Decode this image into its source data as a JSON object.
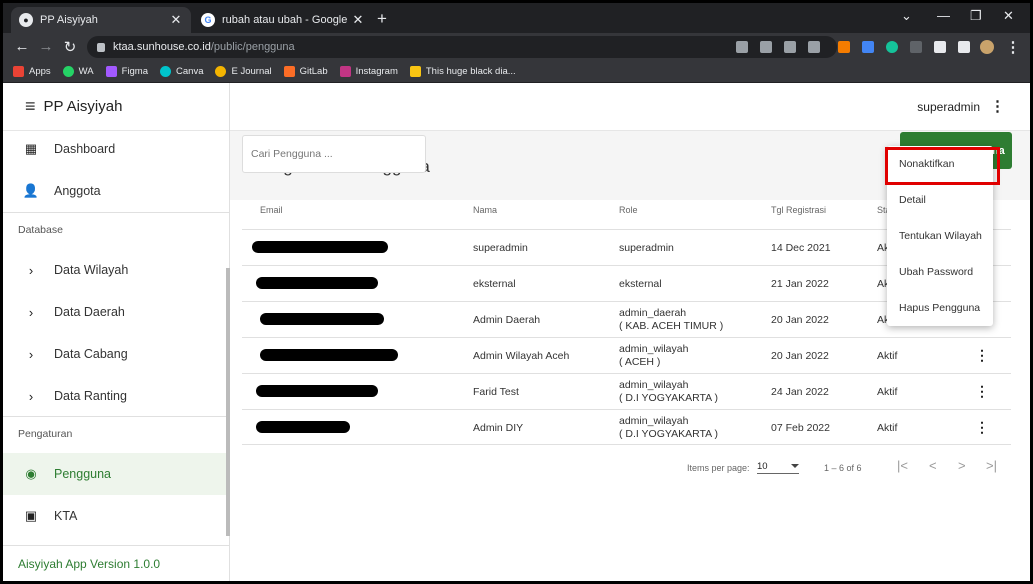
{
  "browser": {
    "tabs": [
      {
        "title": "PP Aisyiyah",
        "active": true
      },
      {
        "title": "rubah atau ubah - Google Nggol",
        "active": false
      }
    ],
    "url_host": "ktaa.sunhouse.co.id",
    "url_path": "/public/pengguna",
    "bookmarks": [
      {
        "label": "Apps",
        "color": "#ea4335"
      },
      {
        "label": "WA",
        "color": "#25d366"
      },
      {
        "label": "Figma",
        "color": "#a259ff"
      },
      {
        "label": "Canva",
        "color": "#00c4cc"
      },
      {
        "label": "E Journal",
        "color": "#f4b400"
      },
      {
        "label": "GitLab",
        "color": "#fc6d26"
      },
      {
        "label": "Instagram",
        "color": "#c13584"
      },
      {
        "label": "This huge black dia...",
        "color": "#f9c513"
      }
    ]
  },
  "app": {
    "title": "PP Aisyiyah",
    "user": "superadmin",
    "version": "Aisyiyah App Version 1.0.0",
    "accent": "#2e7d32"
  },
  "sidebar": {
    "items": [
      {
        "label": "Dashboard",
        "icon": "dashboard-icon"
      },
      {
        "label": "Anggota",
        "icon": "person-icon"
      }
    ],
    "section_database": "Database",
    "database_items": [
      {
        "label": "Data Wilayah",
        "icon": "chevron-right-icon"
      },
      {
        "label": "Data Daerah",
        "icon": "chevron-right-icon"
      },
      {
        "label": "Data Cabang",
        "icon": "chevron-right-icon"
      },
      {
        "label": "Data Ranting",
        "icon": "chevron-right-icon"
      }
    ],
    "section_settings": "Pengaturan",
    "settings_items": [
      {
        "label": "Pengguna",
        "icon": "account-circle-icon",
        "active": true
      },
      {
        "label": "KTA",
        "icon": "badge-icon",
        "active": false
      }
    ]
  },
  "main": {
    "page_title": "Pengelolaan Pengguna",
    "search_placeholder": "Cari Pengguna ...",
    "add_button": "Tambah Pengguna",
    "columns": [
      "Email",
      "Nama",
      "Role",
      "Tgl Registrasi",
      "Status"
    ],
    "rows": [
      {
        "nama": "superadmin",
        "role": "superadmin",
        "role2": "",
        "tgl": "14 Dec 2021",
        "status": "Aktif"
      },
      {
        "nama": "eksternal",
        "role": "eksternal",
        "role2": "",
        "tgl": "21 Jan 2022",
        "status": "Aktif"
      },
      {
        "nama": "Admin Daerah",
        "role": "admin_daerah",
        "role2": "( KAB. ACEH TIMUR )",
        "tgl": "20 Jan 2022",
        "status": "Aktif"
      },
      {
        "nama": "Admin Wilayah Aceh",
        "role": "admin_wilayah",
        "role2": "( ACEH )",
        "tgl": "20 Jan 2022",
        "status": "Aktif"
      },
      {
        "nama": "Farid Test",
        "role": "admin_wilayah",
        "role2": "( D.I YOGYAKARTA )",
        "tgl": "24 Jan 2022",
        "status": "Aktif"
      },
      {
        "nama": "Admin DIY",
        "role": "admin_wilayah",
        "role2": "( D.I YOGYAKARTA )",
        "tgl": "07 Feb 2022",
        "status": "Aktif"
      }
    ],
    "pager": {
      "items_per_page_label": "Items per page:",
      "items_per_page": "10",
      "range": "1 – 6 of 6"
    }
  },
  "context_menu": {
    "items": [
      "Nonaktifkan",
      "Detail",
      "Tentukan Wilayah",
      "Ubah Password",
      "Hapus Pengguna"
    ],
    "highlight_color": "#e00000"
  }
}
